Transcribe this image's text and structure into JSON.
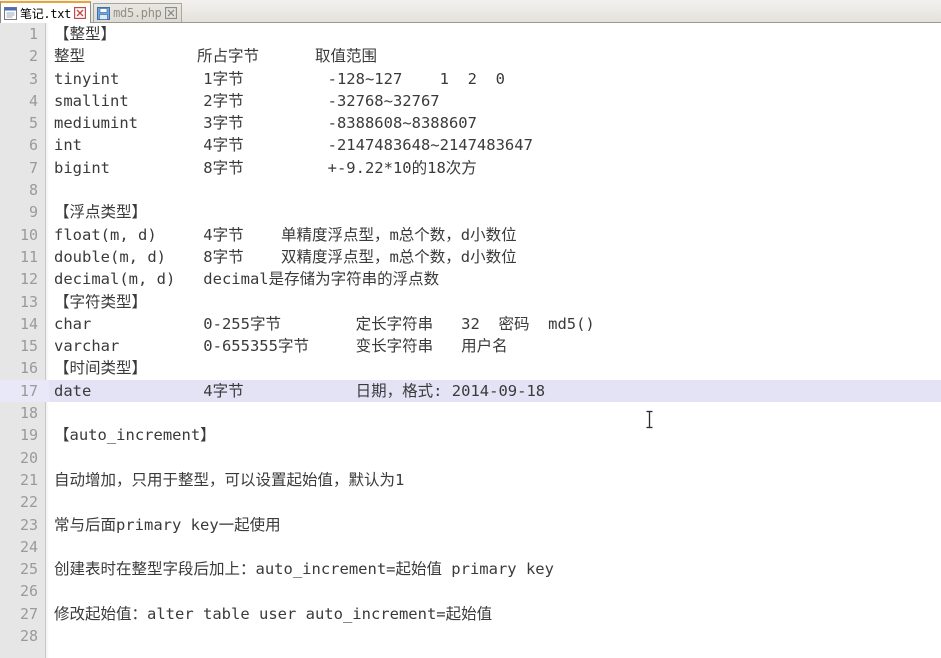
{
  "window": {
    "app_kind": "text-editor",
    "accent_color": "#e8a33d",
    "current_line_highlight": "#e4e3f6",
    "gutter_color": "#e6e6e6"
  },
  "tabs": [
    {
      "label": "笔记.txt",
      "active": true,
      "icon": "document-icon",
      "close_icon": "close-icon"
    },
    {
      "label": "md5.php",
      "active": false,
      "icon": "save-floppy-icon",
      "close_icon": "close-icon"
    }
  ],
  "editor": {
    "current_line": 17,
    "first_line": 1,
    "last_line": 28,
    "lines": [
      {
        "n": "1",
        "text": "【整型】"
      },
      {
        "n": "2",
        "text": "整型            所占字节      取值范围"
      },
      {
        "n": "3",
        "text": "tinyint         1字节         -128~127    1  2  0"
      },
      {
        "n": "4",
        "text": "smallint        2字节         -32768~32767"
      },
      {
        "n": "5",
        "text": "mediumint       3字节         -8388608~8388607"
      },
      {
        "n": "6",
        "text": "int             4字节         -2147483648~2147483647"
      },
      {
        "n": "7",
        "text": "bigint          8字节         +-9.22*10的18次方"
      },
      {
        "n": "8",
        "text": ""
      },
      {
        "n": "9",
        "text": "【浮点类型】"
      },
      {
        "n": "10",
        "text": "float(m, d)     4字节    单精度浮点型，m总个数，d小数位"
      },
      {
        "n": "11",
        "text": "double(m, d)    8字节    双精度浮点型，m总个数，d小数位"
      },
      {
        "n": "12",
        "text": "decimal(m, d)   decimal是存储为字符串的浮点数"
      },
      {
        "n": "13",
        "text": "【字符类型】"
      },
      {
        "n": "14",
        "text": "char            0-255字节        定长字符串   32  密码  md5()"
      },
      {
        "n": "15",
        "text": "varchar         0-655355字节     变长字符串   用户名"
      },
      {
        "n": "16",
        "text": "【时间类型】"
      },
      {
        "n": "17",
        "text": "date            4字节            日期，格式: 2014-09-18"
      },
      {
        "n": "18",
        "text": ""
      },
      {
        "n": "19",
        "text": "【auto_increment】"
      },
      {
        "n": "20",
        "text": ""
      },
      {
        "n": "21",
        "text": "自动增加，只用于整型，可以设置起始值，默认为1"
      },
      {
        "n": "22",
        "text": ""
      },
      {
        "n": "23",
        "text": "常与后面primary key一起使用"
      },
      {
        "n": "24",
        "text": ""
      },
      {
        "n": "25",
        "text": "创建表时在整型字段后加上：auto_increment=起始值 primary key"
      },
      {
        "n": "26",
        "text": ""
      },
      {
        "n": "27",
        "text": "修改起始值：alter table user auto_increment=起始值"
      },
      {
        "n": "28",
        "text": ""
      }
    ]
  }
}
